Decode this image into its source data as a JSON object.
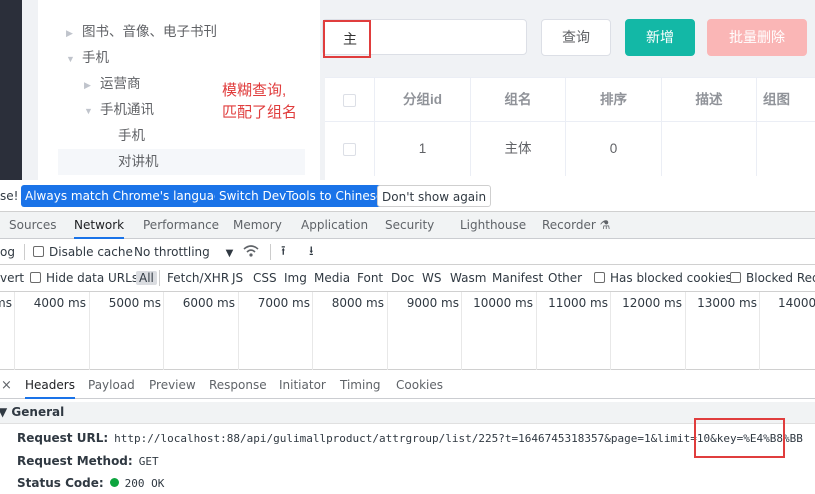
{
  "tree": [
    {
      "label": "图书、音像、电子书刊",
      "caret": "▶"
    },
    {
      "label": "手机",
      "caret": "▼"
    },
    {
      "label": "运营商",
      "caret": "▶"
    },
    {
      "label": "手机通讯",
      "caret": "▼"
    },
    {
      "label": "手机",
      "caret": ""
    },
    {
      "label": "对讲机",
      "caret": ""
    }
  ],
  "search": {
    "value": "主"
  },
  "buttons": {
    "query": "查询",
    "add": "新增",
    "batch_delete": "批量删除"
  },
  "annotation": {
    "line1": "模糊查询,",
    "line2": "匹配了组名"
  },
  "table": {
    "headers": [
      "分组id",
      "组名",
      "排序",
      "描述",
      "组图"
    ],
    "rows": [
      [
        "1",
        "主体",
        "0",
        "",
        ""
      ]
    ]
  },
  "devtools": {
    "lang_bar": {
      "cut": "se!",
      "always": "Always match Chrome's language",
      "switch": "Switch DevTools to Chinese",
      "dont_show": "Don't show again"
    },
    "tabs": [
      "Sources",
      "Network",
      "Performance",
      "Memory",
      "Application",
      "Security",
      "Lighthouse",
      "Recorder"
    ],
    "recorder_icon": "flask-icon",
    "toolbar1": {
      "log": "og",
      "disable_cache": "Disable cache",
      "throttling": "No throttling"
    },
    "toolbar2": {
      "invert": "vert",
      "hide_data_urls": "Hide data URLs",
      "all": "All",
      "types": [
        "Fetch/XHR",
        "JS",
        "CSS",
        "Img",
        "Media",
        "Font",
        "Doc",
        "WS",
        "Wasm",
        "Manifest",
        "Other"
      ],
      "blocked_cookies": "Has blocked cookies",
      "blocked_requests": "Blocked Requ"
    },
    "timeline_ticks": [
      "ms",
      "4000 ms",
      "5000 ms",
      "6000 ms",
      "7000 ms",
      "8000 ms",
      "9000 ms",
      "10000 ms",
      "11000 ms",
      "12000 ms",
      "13000 ms",
      "14000"
    ],
    "detail_tabs": [
      "Headers",
      "Payload",
      "Preview",
      "Response",
      "Initiator",
      "Timing",
      "Cookies"
    ],
    "close": "×",
    "general": {
      "title": "▼ General",
      "request_url_label": "Request URL:",
      "request_url": "http://localhost:88/api/gulimallproduct/attrgroup/list/225?t=1646745318357&page=1&limit=10&key=%E4%B8%BB",
      "request_method_label": "Request Method:",
      "request_method": "GET",
      "status_code_label": "Status Code:",
      "status_code": "200 OK"
    }
  },
  "colors": {
    "teal": "#13b8a6",
    "danger_light": "#fab6b6",
    "annotation_red": "#e03d3d",
    "blue": "#1a73e8"
  }
}
